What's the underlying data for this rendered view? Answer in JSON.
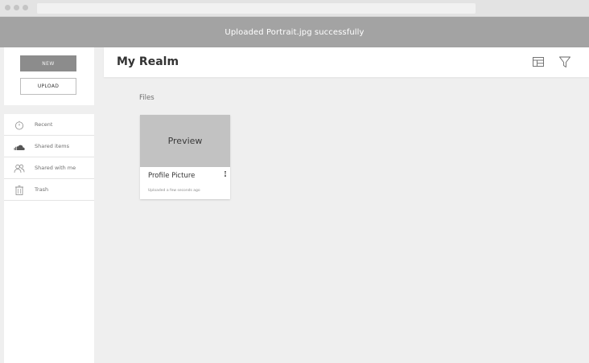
{
  "notification": {
    "text": "Uploaded Portrait.jpg successfully"
  },
  "sidebar": {
    "new_label": "NEW",
    "upload_label": "UPLOAD",
    "items": [
      {
        "label": "Recent",
        "icon": "clock-icon"
      },
      {
        "label": "Shared items",
        "icon": "cloud-icon"
      },
      {
        "label": "Shared with me",
        "icon": "people-icon"
      },
      {
        "label": "Trash",
        "icon": "trash-icon"
      }
    ]
  },
  "header": {
    "title": "My Realm",
    "icons": [
      "layout-icon",
      "filter-icon"
    ]
  },
  "main": {
    "section_label": "Files",
    "files": [
      {
        "preview_text": "Preview",
        "name": "Profile Picture",
        "meta": "Uploaded a few seconds ago"
      }
    ]
  },
  "colors": {
    "banner": "#a3a3a3",
    "new_button": "#8c8c8c",
    "preview": "#c2c2c2",
    "background": "#efefef"
  }
}
